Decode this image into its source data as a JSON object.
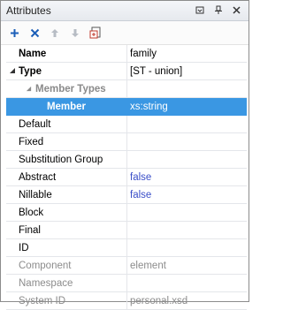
{
  "window": {
    "title": "Attributes"
  },
  "title_controls": [
    "dropdown-icon",
    "pin-icon",
    "close-icon"
  ],
  "toolbar": [
    "add-icon",
    "remove-icon",
    "move-up-icon",
    "move-down-icon",
    "open-in-editor-icon"
  ],
  "rows": [
    {
      "name": "Name",
      "value": "family"
    },
    {
      "name": "Type",
      "value": "[ST - union]"
    },
    {
      "name": "Member Types",
      "value": ""
    },
    {
      "name": "Member",
      "value": "xs:string"
    },
    {
      "name": "Default",
      "value": ""
    },
    {
      "name": "Fixed",
      "value": ""
    },
    {
      "name": "Substitution Group",
      "value": ""
    },
    {
      "name": "Abstract",
      "value": "false"
    },
    {
      "name": "Nillable",
      "value": "false"
    },
    {
      "name": "Block",
      "value": ""
    },
    {
      "name": "Final",
      "value": ""
    },
    {
      "name": "ID",
      "value": ""
    },
    {
      "name": "Component",
      "value": "element"
    },
    {
      "name": "Namespace",
      "value": ""
    },
    {
      "name": "System ID",
      "value": "personal.xsd"
    }
  ],
  "colors": {
    "selection": "#3a97e3",
    "value_blue": "#3a4ec8",
    "disabled_gray": "#8c8c8c"
  }
}
